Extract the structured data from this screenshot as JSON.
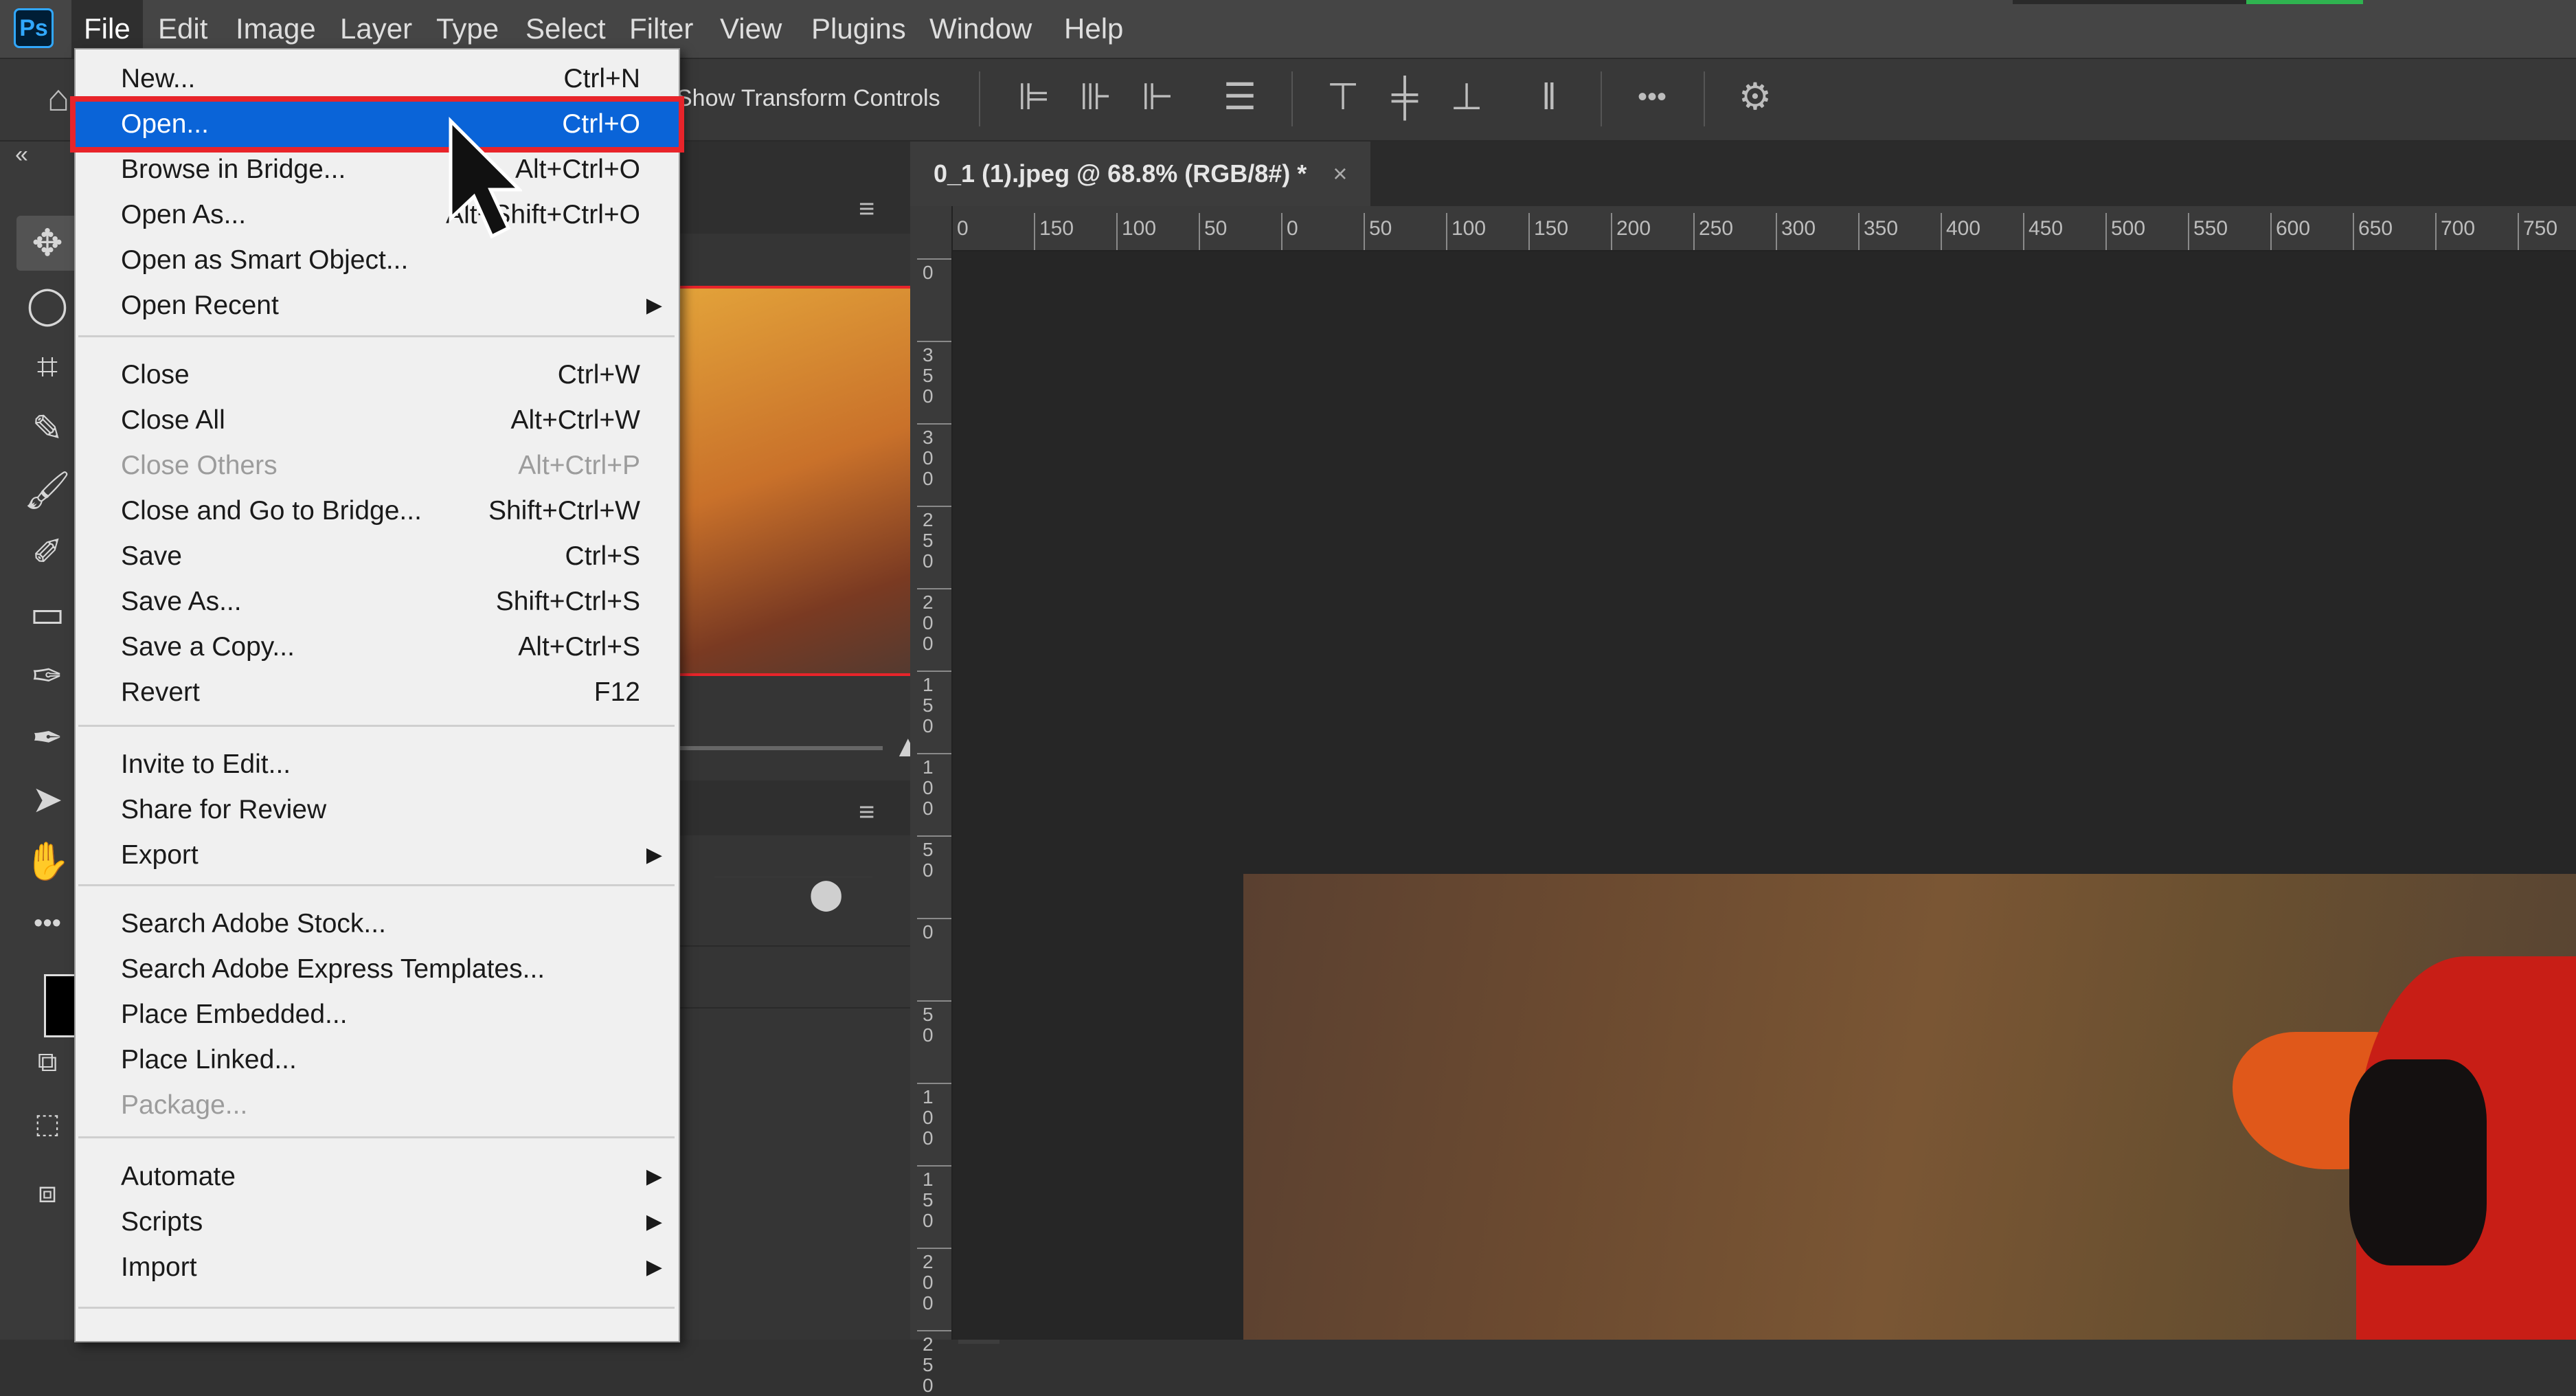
{
  "app": {
    "logo": "Ps"
  },
  "menubar": {
    "items": [
      "File",
      "Edit",
      "Image",
      "Layer",
      "Type",
      "Select",
      "Filter",
      "View",
      "Plugins",
      "Window",
      "Help"
    ],
    "active": "File"
  },
  "options_bar": {
    "transform_label": "Show Transform Controls",
    "more_label": "•••"
  },
  "toolbar": {
    "collapse_label": "«",
    "more_label": "•••"
  },
  "document": {
    "tab_title": "0_1 (1).jpeg @ 68.8% (RGB/8#) *",
    "close_label": "×",
    "ruler_h": [
      "0",
      "150",
      "100",
      "50",
      "0",
      "50",
      "100",
      "150",
      "200",
      "250",
      "300",
      "350",
      "400",
      "450",
      "500",
      "550",
      "600",
      "650",
      "700",
      "750"
    ],
    "ruler_v": [
      "0",
      "350",
      "300",
      "250",
      "200",
      "150",
      "100",
      "50",
      "0",
      "50",
      "100",
      "150",
      "200",
      "250"
    ]
  },
  "file_menu": {
    "items": [
      {
        "label": "New...",
        "shortcut": "Ctrl+N"
      },
      {
        "label": "Open...",
        "shortcut": "Ctrl+O"
      },
      {
        "label": "Browse in Bridge...",
        "shortcut": "Alt+Ctrl+O"
      },
      {
        "label": "Open As...",
        "shortcut": "Alt+Shift+Ctrl+O"
      },
      {
        "label": "Open as Smart Object...",
        "shortcut": ""
      },
      {
        "label": "Open Recent",
        "shortcut": ""
      },
      {
        "label": "Close",
        "shortcut": "Ctrl+W"
      },
      {
        "label": "Close All",
        "shortcut": "Alt+Ctrl+W"
      },
      {
        "label": "Close Others",
        "shortcut": "Alt+Ctrl+P"
      },
      {
        "label": "Close and Go to Bridge...",
        "shortcut": "Shift+Ctrl+W"
      },
      {
        "label": "Save",
        "shortcut": "Ctrl+S"
      },
      {
        "label": "Save As...",
        "shortcut": "Shift+Ctrl+S"
      },
      {
        "label": "Save a Copy...",
        "shortcut": "Alt+Ctrl+S"
      },
      {
        "label": "Revert",
        "shortcut": "F12"
      },
      {
        "label": "Invite to Edit...",
        "shortcut": ""
      },
      {
        "label": "Share for Review",
        "shortcut": ""
      },
      {
        "label": "Export",
        "shortcut": ""
      },
      {
        "label": "Search Adobe Stock...",
        "shortcut": ""
      },
      {
        "label": "Search Adobe Express Templates...",
        "shortcut": ""
      },
      {
        "label": "Place Embedded...",
        "shortcut": ""
      },
      {
        "label": "Place Linked...",
        "shortcut": ""
      },
      {
        "label": "Package...",
        "shortcut": ""
      },
      {
        "label": "Automate",
        "shortcut": ""
      },
      {
        "label": "Scripts",
        "shortcut": ""
      },
      {
        "label": "Import",
        "shortcut": ""
      }
    ],
    "submenu_arrow": "▶"
  },
  "colors": {
    "accent_blue": "#0a64d8",
    "highlight_red": "#e8242a",
    "ps_blue": "#31a8ff"
  }
}
